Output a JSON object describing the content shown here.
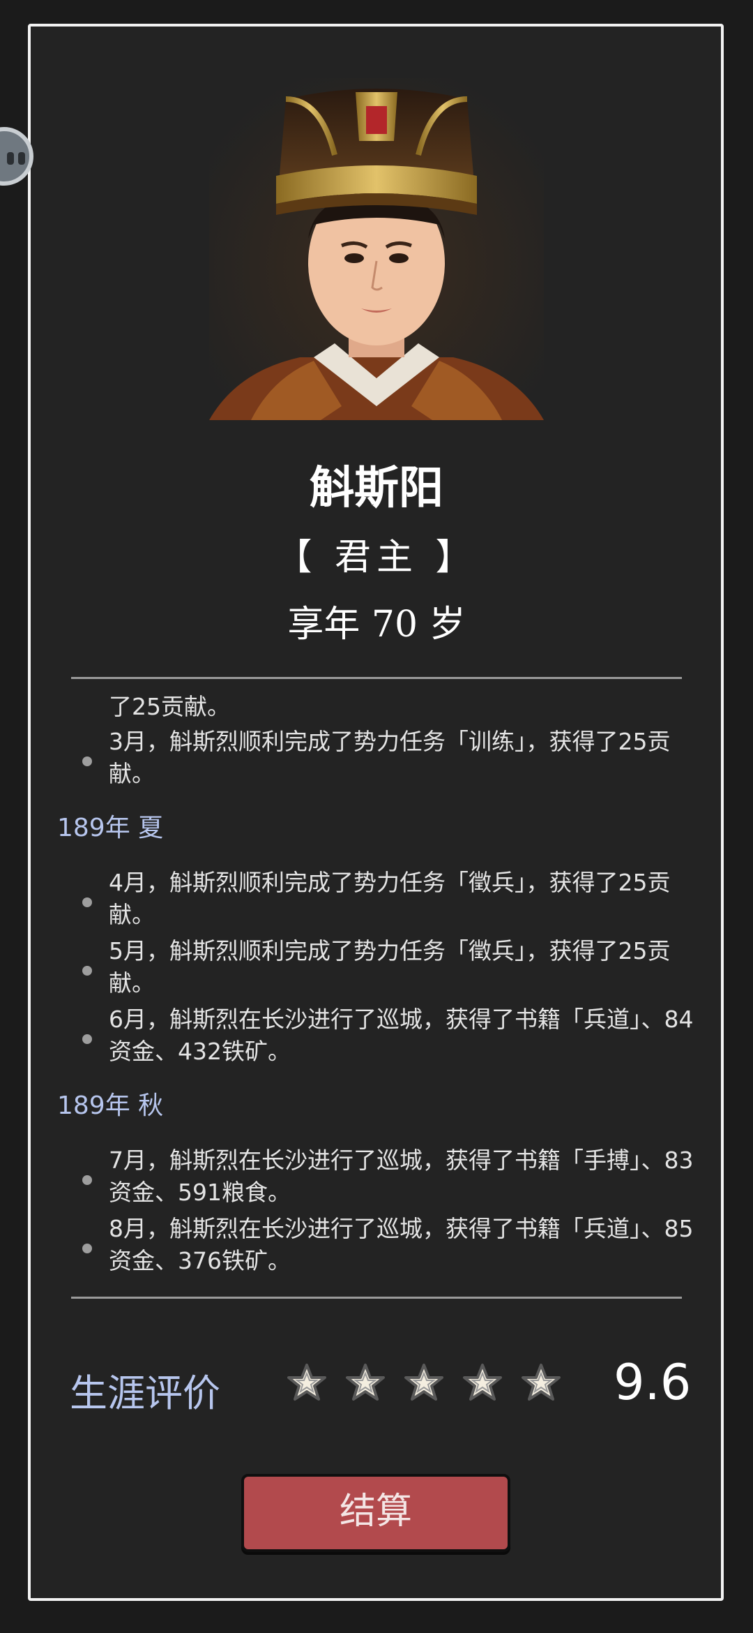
{
  "character": {
    "name": "斛斯阳",
    "role": "【 君主 】",
    "age": "享年 70 岁"
  },
  "log": {
    "fragment": "了25贡献。",
    "first_entries": [
      "3月，斛斯烈顺利完成了势力任务「训练」，获得了25贡献。"
    ],
    "seasons": [
      {
        "title": "189年 夏",
        "entries": [
          "4月，斛斯烈顺利完成了势力任务「徵兵」，获得了25贡献。",
          "5月，斛斯烈顺利完成了势力任务「徵兵」，获得了25贡献。",
          "6月，斛斯烈在长沙进行了巡城，获得了书籍「兵道」、84资金、432铁矿。"
        ]
      },
      {
        "title": "189年 秋",
        "entries": [
          "7月，斛斯烈在长沙进行了巡城，获得了书籍「手搏」、83资金、591粮食。",
          "8月，斛斯烈在长沙进行了巡城，获得了书籍「兵道」、85资金、376铁矿。"
        ]
      }
    ]
  },
  "rating": {
    "label": "生涯评价",
    "stars_filled": 5,
    "stars_total": 5,
    "score": "9.6"
  },
  "settle_button": {
    "label": "结算"
  },
  "colors": {
    "accent_text": "#b7c6ee",
    "button_red": "#b24a4d"
  }
}
